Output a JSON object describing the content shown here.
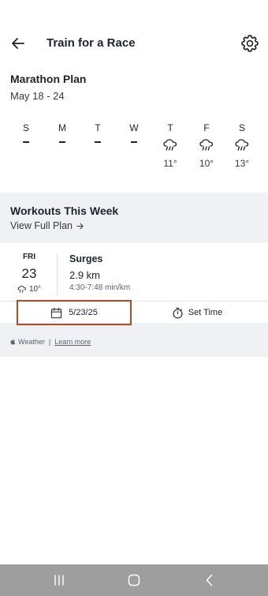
{
  "header": {
    "title": "Train for a Race",
    "back_icon": "arrow-left-icon",
    "settings_icon": "gear-icon"
  },
  "plan": {
    "title": "Marathon Plan",
    "dates": "May 18 - 24"
  },
  "week": [
    {
      "letter": "S",
      "forecast": null
    },
    {
      "letter": "M",
      "forecast": null
    },
    {
      "letter": "T",
      "forecast": null
    },
    {
      "letter": "W",
      "forecast": null
    },
    {
      "letter": "T",
      "forecast": {
        "icon": "rain-cloud-icon",
        "temp": "11°"
      }
    },
    {
      "letter": "F",
      "forecast": {
        "icon": "rain-cloud-icon",
        "temp": "10°"
      }
    },
    {
      "letter": "S",
      "forecast": {
        "icon": "rain-cloud-icon",
        "temp": "13°"
      }
    }
  ],
  "workouts": {
    "title": "Workouts This Week",
    "view_full_plan": "View Full Plan",
    "card": {
      "day_of_week": "FRI",
      "day_number": "23",
      "weather_temp": "10°",
      "name": "Surges",
      "distance": "2.9 km",
      "pace": "4:30-7:48 min/km",
      "date_button": "5/23/25",
      "set_time_button": "Set Time"
    }
  },
  "weather_credit": {
    "brand": "Weather",
    "separator": "|",
    "learn_more": "Learn more"
  },
  "colors": {
    "accent_outline": "#b8471f",
    "section_bg": "#eff1f3",
    "nav_bar": "#9e9e9e"
  }
}
